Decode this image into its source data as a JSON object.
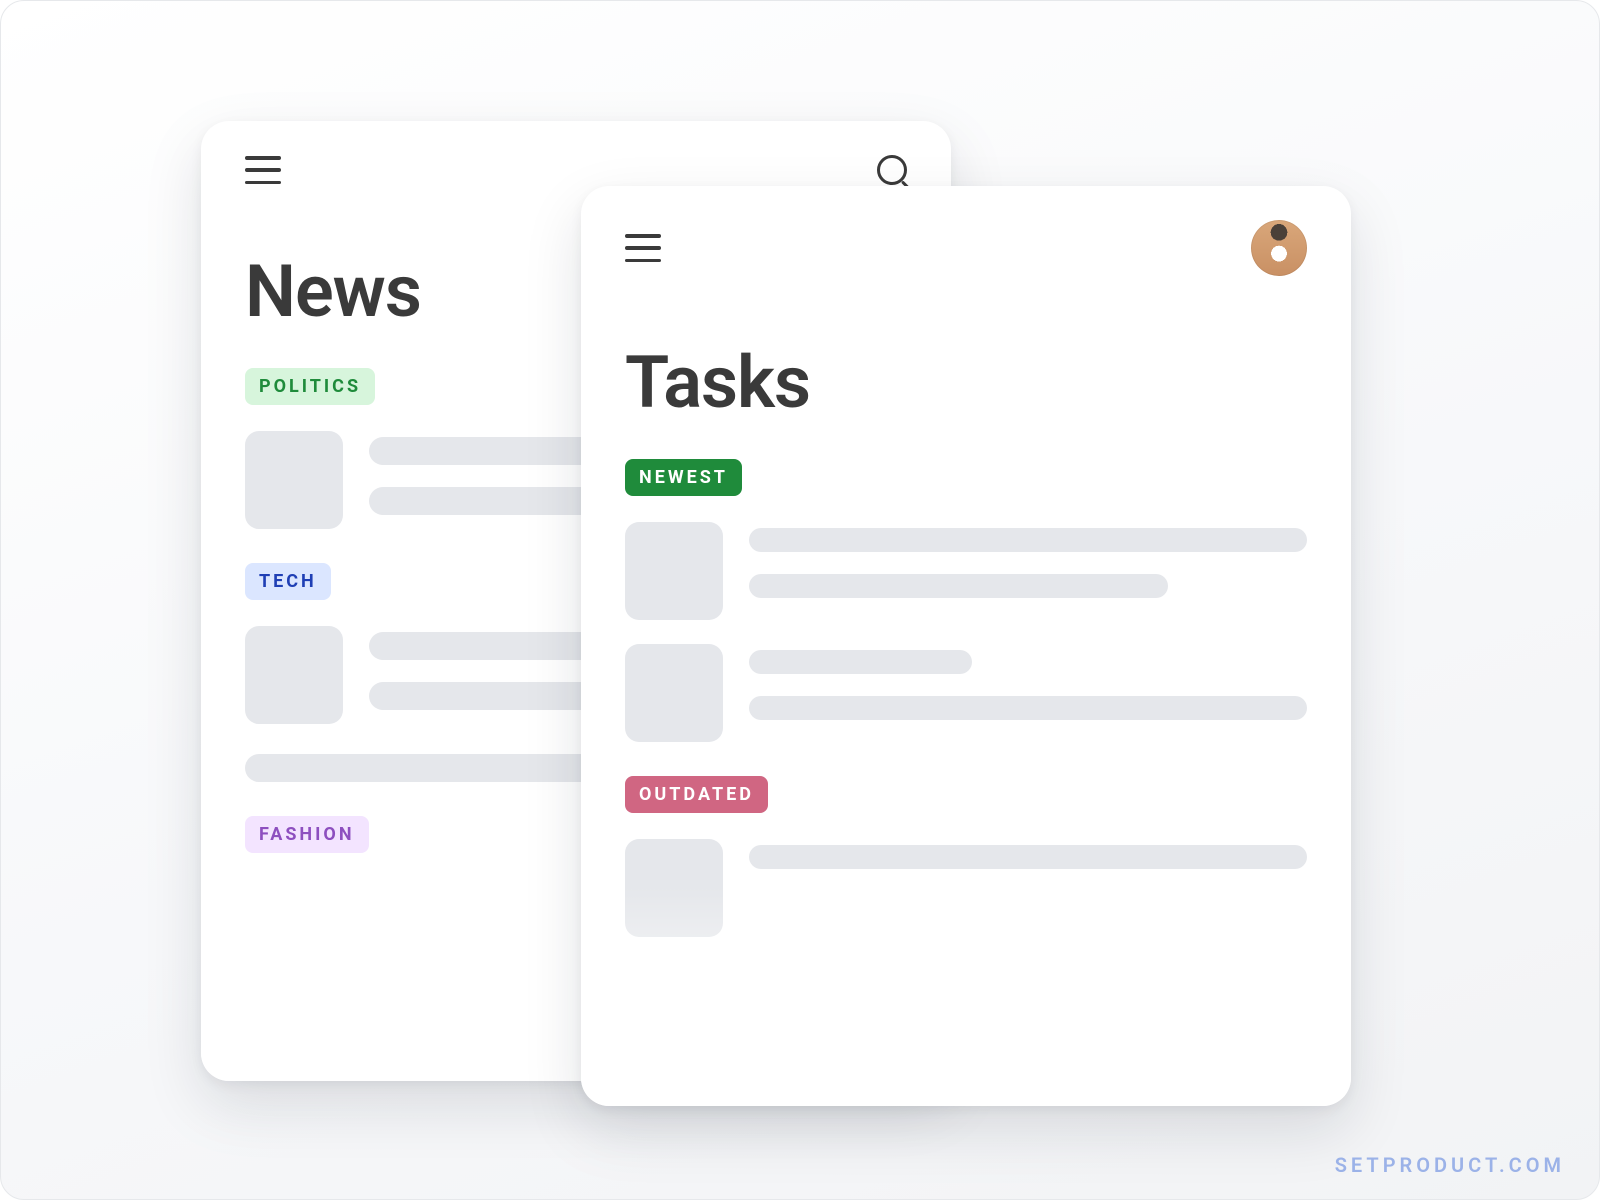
{
  "watermark": "SETPRODUCT.COM",
  "cards": {
    "back": {
      "title": "News",
      "sections": [
        {
          "label": "POLITICS",
          "chip_class": "green-light"
        },
        {
          "label": "TECH",
          "chip_class": "blue-light"
        },
        {
          "label": "FASHION",
          "chip_class": "purple-light"
        }
      ]
    },
    "front": {
      "title": "Tasks",
      "sections": [
        {
          "label": "NEWEST",
          "chip_class": "green-solid"
        },
        {
          "label": "OUTDATED",
          "chip_class": "pink-solid"
        }
      ]
    }
  }
}
